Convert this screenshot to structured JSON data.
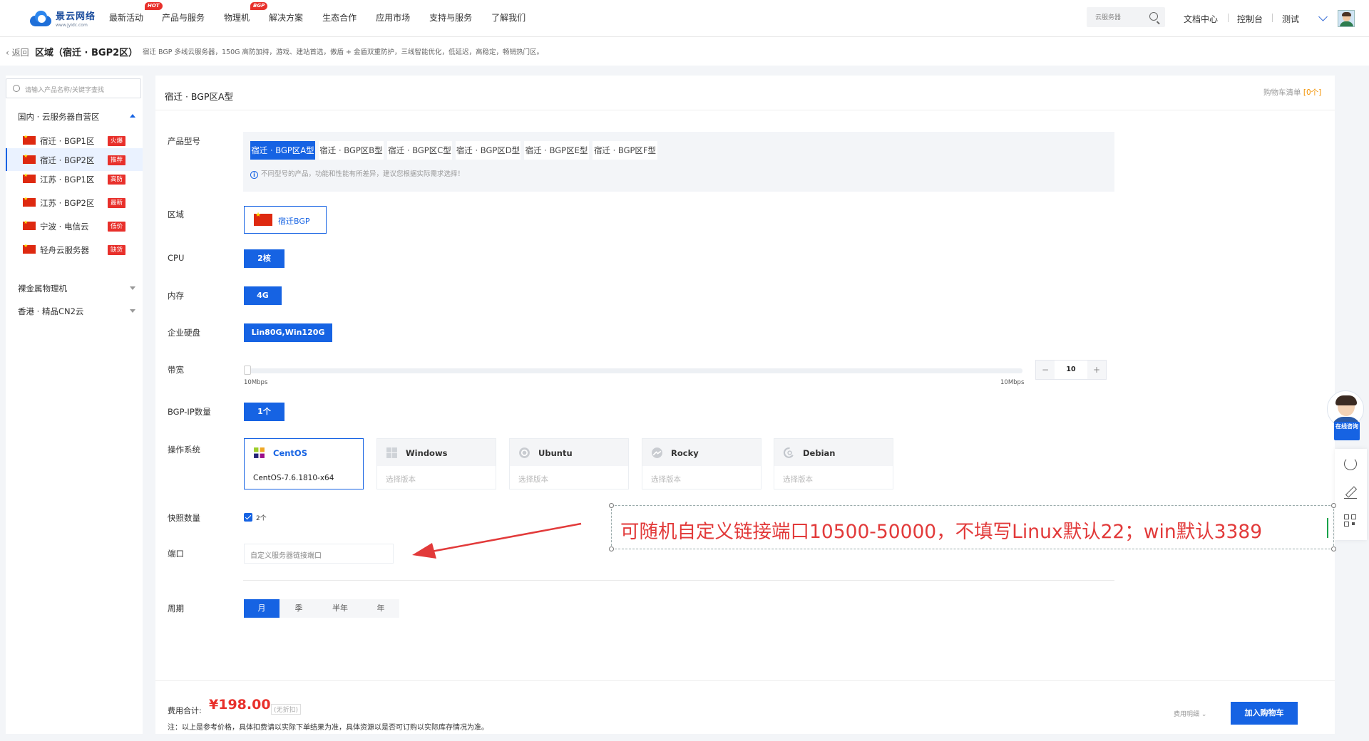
{
  "brand": {
    "name": "景云网络",
    "domain": "www.jyidc.com"
  },
  "nav": {
    "items": [
      {
        "label": "最新活动",
        "badge": "HOT"
      },
      {
        "label": "产品与服务",
        "badge": ""
      },
      {
        "label": "物理机",
        "badge": "BGP"
      },
      {
        "label": "解决方案",
        "badge": ""
      },
      {
        "label": "生态合作",
        "badge": ""
      },
      {
        "label": "应用市场",
        "badge": ""
      },
      {
        "label": "支持与服务",
        "badge": ""
      },
      {
        "label": "了解我们",
        "badge": ""
      }
    ],
    "search_placeholder": "云服务器",
    "docs": "文档中心",
    "console": "控制台",
    "user": "测试"
  },
  "breadcrumb": {
    "back": "返回",
    "title": "区域（宿迁 · BGP2区）",
    "desc": "宿迁 BGP 多线云服务器，150G 高防加持，游戏、建站首选，傲盾 + 金盾双重防护，三线智能优化，低延迟，高稳定，畅销热门区。"
  },
  "sidebar": {
    "search_placeholder": "请输入产品名称/关键字查找",
    "group1": "国内 · 云服务器自营区",
    "items": [
      {
        "label": "宿迁 · BGP1区",
        "tag": "火爆",
        "tag_color": "#e8302b"
      },
      {
        "label": "宿迁 · BGP2区",
        "tag": "推荐",
        "tag_color": "#e8302b"
      },
      {
        "label": "江苏 · BGP1区",
        "tag": "高防",
        "tag_color": "#e8302b"
      },
      {
        "label": "江苏 · BGP2区",
        "tag": "最新",
        "tag_color": "#e8302b"
      },
      {
        "label": "宁波 · 电信云",
        "tag": "低价",
        "tag_color": "#e8302b"
      },
      {
        "label": "轻舟云服务器",
        "tag": "缺货",
        "tag_color": "#e8302b"
      }
    ],
    "group2": "裸金属物理机",
    "group3": "香港 · 精品CN2云"
  },
  "panel": {
    "title": "宿迁 · BGP区A型",
    "cart_list": "购物车清单",
    "cart_count": "0个"
  },
  "form": {
    "model_label": "产品型号",
    "models": [
      "宿迁 · BGP区A型",
      "宿迁 · BGP区B型",
      "宿迁 · BGP区C型",
      "宿迁 · BGP区D型",
      "宿迁 · BGP区E型",
      "宿迁 · BGP区F型"
    ],
    "model_note": "不同型号的产品，功能和性能有所差异，建议您根据实际需求选择！",
    "region_label": "区域",
    "region_value": "宿迁BGP",
    "cpu_label": "CPU",
    "cpu_value": "2核",
    "mem_label": "内存",
    "mem_value": "4G",
    "disk_label": "企业硬盘",
    "disk_value": "Lin80G,Win120G",
    "bw_label": "带宽",
    "bw_min": "10Mbps",
    "bw_max": "10Mbps",
    "bw_value": "10",
    "ip_label": "BGP-IP数量",
    "ip_value": "1个",
    "os_label": "操作系统",
    "os": [
      {
        "name": "CentOS",
        "version": "CentOS-7.6.1810-x64"
      },
      {
        "name": "Windows",
        "version": "选择版本"
      },
      {
        "name": "Ubuntu",
        "version": "选择版本"
      },
      {
        "name": "Rocky",
        "version": "选择版本"
      },
      {
        "name": "Debian",
        "version": "选择版本"
      }
    ],
    "snapshot_label": "快照数量",
    "snapshot_value": "2个",
    "port_label": "端口",
    "port_placeholder": "自定义服务器链接端口",
    "cycle_label": "周期",
    "cycles": [
      "月",
      "季",
      "半年",
      "年"
    ]
  },
  "footer": {
    "fee_label": "费用合计:",
    "price": "¥198.00",
    "discount": "(无折扣)",
    "note": "注：以上是参考价格，具体扣费请以实际下单结果为准，具体资源以是否可订购以实际库存情况为准。",
    "detail": "费用明细",
    "add_cart": "加入购物车"
  },
  "float": {
    "consult": "在线咨询"
  },
  "annotation": {
    "text": "可随机自定义链接端口10500-50000，不填写Linux默认22；win默认3389",
    "color": "#e23a3a"
  }
}
